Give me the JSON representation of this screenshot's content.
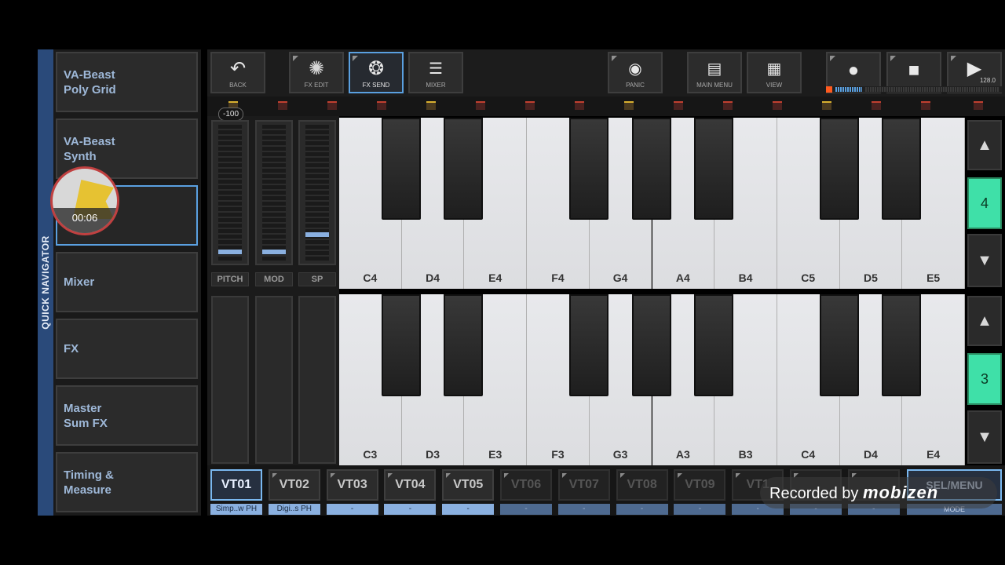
{
  "quick_navigator": {
    "title": "QUICK NAVIGATOR",
    "items": [
      {
        "label": "VA-Beast\nPoly Grid",
        "active": false
      },
      {
        "label": "VA-Beast\nSynth",
        "active": false
      },
      {
        "label": "",
        "active": true
      },
      {
        "label": "Mixer",
        "active": false
      },
      {
        "label": "FX",
        "active": false
      },
      {
        "label": "Master\nSum FX",
        "active": false
      },
      {
        "label": "Timing &\nMeasure",
        "active": false
      }
    ]
  },
  "recorder_overlay": {
    "time": "00:06"
  },
  "toolbar": {
    "back": "BACK",
    "fx_edit": "FX EDIT",
    "fx_send": "FX SEND",
    "mixer": "MIXER",
    "panic": "PANIC",
    "main_menu": "MAIN MENU",
    "view": "VIEW",
    "tempo": "128.0"
  },
  "controls": {
    "pitch_value": "-100",
    "sliders": [
      {
        "label": "PITCH",
        "level": 0.05
      },
      {
        "label": "MOD",
        "level": 0.05
      },
      {
        "label": "SP",
        "level": 0.18
      }
    ]
  },
  "keyboard_upper": {
    "octave": "4",
    "white_keys": [
      "C4",
      "D4",
      "E4",
      "F4",
      "G4",
      "A4",
      "B4",
      "C5",
      "D5",
      "E5"
    ]
  },
  "keyboard_lower": {
    "octave": "3",
    "white_keys": [
      "C3",
      "D3",
      "E3",
      "F3",
      "G3",
      "A3",
      "B3",
      "C4",
      "D4",
      "E4"
    ]
  },
  "tracks": [
    {
      "label": "VT01",
      "name": "Simp..w PH",
      "active": true,
      "dim": false
    },
    {
      "label": "VT02",
      "name": "Digi..s PH",
      "active": false,
      "dim": false
    },
    {
      "label": "VT03",
      "name": "-",
      "active": false,
      "dim": false
    },
    {
      "label": "VT04",
      "name": "-",
      "active": false,
      "dim": false
    },
    {
      "label": "VT05",
      "name": "-",
      "active": false,
      "dim": false
    },
    {
      "label": "VT06",
      "name": "-",
      "active": false,
      "dim": true
    },
    {
      "label": "VT07",
      "name": "-",
      "active": false,
      "dim": true
    },
    {
      "label": "VT08",
      "name": "-",
      "active": false,
      "dim": true
    },
    {
      "label": "VT09",
      "name": "-",
      "active": false,
      "dim": true
    },
    {
      "label": "VT1",
      "name": "-",
      "active": false,
      "dim": true
    },
    {
      "label": "",
      "name": "-",
      "active": false,
      "dim": true
    },
    {
      "label": "",
      "name": "-",
      "active": false,
      "dim": true
    }
  ],
  "sel_menu": {
    "label": "SEL/MENU",
    "mode": "MODE"
  },
  "watermark": {
    "text": "Recorded by",
    "brand": "mobizen"
  },
  "colors": {
    "accent": "#5aa0e0",
    "octave": "#3fe0a8",
    "record_orange": "#ff5a1e"
  }
}
